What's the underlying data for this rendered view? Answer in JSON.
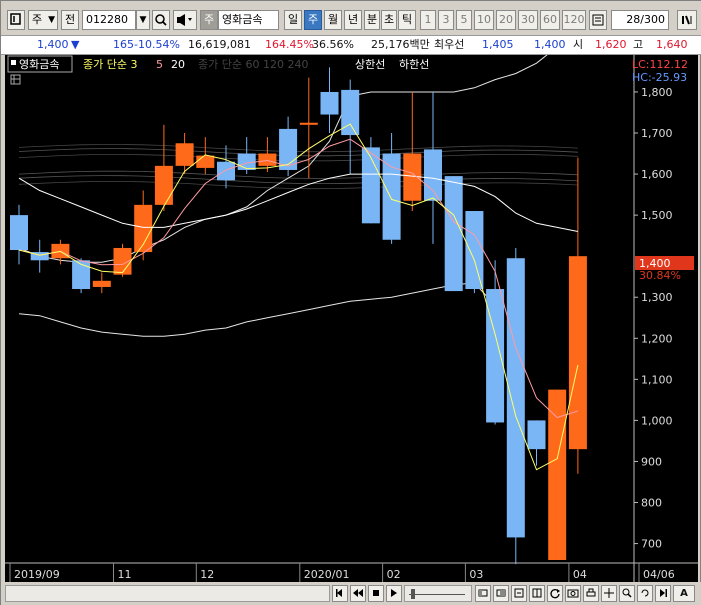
{
  "toolbar": {
    "market_label": "주",
    "prev_label": "전",
    "stock_code": "012280",
    "stock_name": "영화금속",
    "period_day": "일",
    "period_week": "주",
    "period_month": "월",
    "period_year": "년",
    "period_minute": "분",
    "period_second": "초",
    "period_tick": "틱",
    "interval_options": [
      "1",
      "3",
      "5",
      "10",
      "20",
      "30",
      "60",
      "120"
    ],
    "page_counter": "28/300",
    "stock_badge": "주",
    "selected_period": "주"
  },
  "price_info": {
    "current_price": "1,400",
    "change_arrow": "▼",
    "change": "165",
    "change_pct": "-10.54%",
    "volume": "16,619,081",
    "volume_ratio": "164.45%",
    "turnover_ratio": "36.56%",
    "trading_value": "25,176백만",
    "best_bid_label": "최우선",
    "best_bid": "1,405",
    "best_ask": "1,400",
    "open_label": "시",
    "open": "1,620",
    "high_label": "고",
    "high": "1,640"
  },
  "chart": {
    "legend_title": "영화금속",
    "ma_legend": "종가 단순 3",
    "ma_5": "5",
    "ma_20": "20",
    "ma_faded": "종가 단순 60  120  240",
    "upper_limit_label": "상한선",
    "lower_limit_label": "하한선",
    "lc_label": "LC:112.12",
    "hc_label": "HC:-25.93",
    "current_price_tag": "1,400",
    "current_pct_tag": "30.84%",
    "y_ticks": [
      "1,800",
      "1,700",
      "1,600",
      "1,500",
      "1,300",
      "1,200",
      "1,100",
      "1,000",
      "900",
      "800",
      "700"
    ],
    "x_labels": [
      "2019/09",
      "11",
      "12",
      "2020/01",
      "02",
      "03",
      "04",
      "04/06"
    ],
    "colors": {
      "up": "#ff6a1a",
      "down": "#7ab6f5",
      "ma3": "#ffff66",
      "ma5": "#ff9aa2",
      "background": "#000000"
    }
  },
  "chart_data": {
    "type": "candlestick",
    "title": "영화금속",
    "ylim": [
      660,
      1890
    ],
    "categories": [
      "2019/09-1",
      "2019/09-2",
      "2019/09-3",
      "2019/10-1",
      "2019/10-2",
      "2019/10-3",
      "2019/10-4",
      "2019/11-1",
      "2019/11-2",
      "2019/11-3",
      "2019/11-4",
      "2019/12-1",
      "2019/12-2",
      "2019/12-3",
      "2019/12-4",
      "2020/01-1",
      "2020/01-2",
      "2020/01-3",
      "2020/01-4",
      "2020/02-1",
      "2020/02-2",
      "2020/02-3",
      "2020/02-4",
      "2020/03-1",
      "2020/03-2",
      "2020/03-3",
      "2020/03-4",
      "2020/04-1"
    ],
    "open": [
      1500,
      1410,
      1395,
      1390,
      1325,
      1355,
      1410,
      1525,
      1620,
      1615,
      1630,
      1650,
      1620,
      1710,
      1720,
      1800,
      1805,
      1665,
      1650,
      1535,
      1660,
      1595,
      1510,
      1320,
      1395,
      1000,
      660,
      930
    ],
    "close": [
      1415,
      1390,
      1430,
      1320,
      1340,
      1420,
      1525,
      1620,
      1675,
      1645,
      1585,
      1610,
      1650,
      1610,
      1725,
      1745,
      1695,
      1480,
      1440,
      1650,
      1535,
      1315,
      1320,
      995,
      715,
      930,
      1075,
      1400
    ],
    "high": [
      1525,
      1440,
      1440,
      1395,
      1360,
      1430,
      1560,
      1720,
      1700,
      1690,
      1670,
      1690,
      1690,
      1740,
      1835,
      1860,
      1830,
      1690,
      1700,
      1800,
      1800,
      1595,
      1510,
      1390,
      1420,
      1000,
      940,
      1640
    ],
    "low": [
      1380,
      1360,
      1380,
      1310,
      1310,
      1350,
      1390,
      1510,
      1600,
      1600,
      1565,
      1600,
      1605,
      1595,
      1590,
      1700,
      1600,
      1480,
      1430,
      1510,
      1430,
      1315,
      1310,
      990,
      650,
      890,
      850,
      870
    ]
  }
}
